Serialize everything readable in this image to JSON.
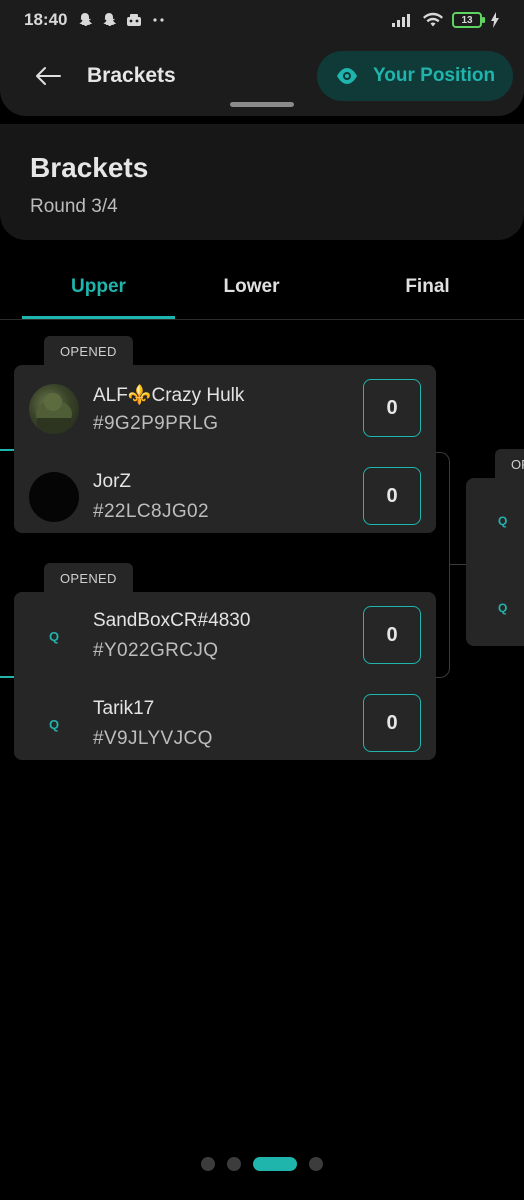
{
  "status_bar": {
    "time": "18:40",
    "battery": "13",
    "icons": [
      "snapchat-icon",
      "snapchat-icon",
      "game-icon",
      "more-dots-icon",
      "signal-icon",
      "wifi-icon",
      "battery-icon",
      "charging-icon"
    ]
  },
  "app_bar": {
    "title": "Brackets",
    "position_button": "Your Position"
  },
  "header": {
    "title": "Brackets",
    "subtitle": "Round 3/4"
  },
  "tabs": [
    {
      "label": "Upper",
      "active": true
    },
    {
      "label": "Lower",
      "active": false
    },
    {
      "label": "Final",
      "active": false
    }
  ],
  "matches": [
    {
      "status": "OPENED",
      "players": [
        {
          "name": "ALF⚜️Crazy Hulk",
          "tag": "#9G2P9PRLG",
          "score": "0",
          "avatar": "photo"
        },
        {
          "name": "JorZ",
          "tag": "#22LC8JG02",
          "score": "0",
          "avatar": "dark"
        }
      ]
    },
    {
      "status": "OPENED",
      "players": [
        {
          "name": "SandBoxCR#4830",
          "tag": "#Y022GRCJQ",
          "score": "0",
          "avatar": "q"
        },
        {
          "name": "Tarik17",
          "tag": "#V9JLYVJCQ",
          "score": "0",
          "avatar": "q"
        }
      ]
    }
  ],
  "next_match": {
    "status": "OPENED",
    "placeholder_glyph": "Q"
  },
  "placeholder_glyph": "Q",
  "pager": {
    "count": 4,
    "active": 2
  },
  "colors": {
    "accent": "#1fb4ac",
    "card": "#262626",
    "background": "#000000"
  }
}
